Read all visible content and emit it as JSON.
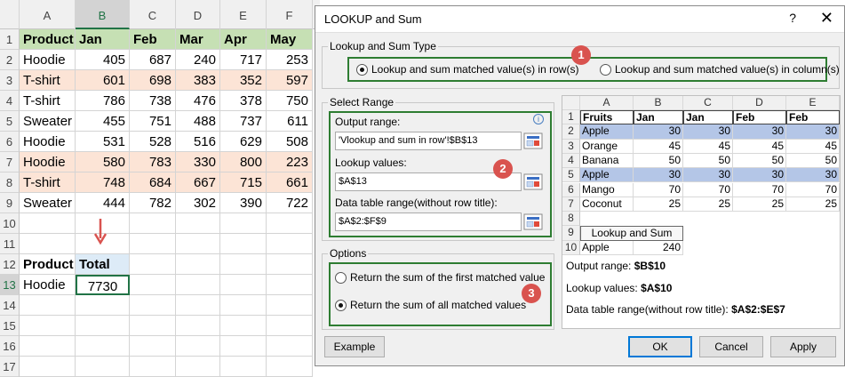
{
  "sheet": {
    "columns": [
      "A",
      "B",
      "C",
      "D",
      "E",
      "F"
    ],
    "rows": [
      "1",
      "2",
      "3",
      "4",
      "5",
      "6",
      "7",
      "8",
      "9",
      "10",
      "11",
      "12",
      "13",
      "14",
      "15",
      "16",
      "17"
    ],
    "header": [
      "Product",
      "Jan",
      "Feb",
      "Mar",
      "Apr",
      "May"
    ],
    "data": [
      [
        "Hoodie",
        "405",
        "687",
        "240",
        "717",
        "253"
      ],
      [
        "T-shirt",
        "601",
        "698",
        "383",
        "352",
        "597"
      ],
      [
        "T-shirt",
        "786",
        "738",
        "476",
        "378",
        "750"
      ],
      [
        "Sweater",
        "455",
        "751",
        "488",
        "737",
        "611"
      ],
      [
        "Hoodie",
        "531",
        "528",
        "516",
        "629",
        "508"
      ],
      [
        "Hoodie",
        "580",
        "783",
        "330",
        "800",
        "223"
      ],
      [
        "T-shirt",
        "748",
        "684",
        "667",
        "715",
        "661"
      ],
      [
        "Sweater",
        "444",
        "782",
        "302",
        "390",
        "722"
      ]
    ],
    "result_header": [
      "Product",
      "Total"
    ],
    "result_row": [
      "Hoodie",
      "7730"
    ]
  },
  "dialog": {
    "title": "LOOKUP and Sum",
    "help": "?",
    "close": "✕",
    "type_group": "Lookup and Sum Type",
    "type_row": "Lookup and sum matched value(s) in row(s)",
    "type_col": "Lookup and sum matched value(s) in column(s)",
    "range_group": "Select Range",
    "output_label": "Output range:",
    "output_value": "'Vlookup and sum in row'!$B$13",
    "lookup_label": "Lookup values:",
    "lookup_value": "$A$13",
    "table_label": "Data table range(without row title):",
    "table_value": "$A$2:$F$9",
    "options_group": "Options",
    "opt_first": "Return the sum of the first matched value",
    "opt_all": "Return the sum of all matched values",
    "badges": [
      "1",
      "2",
      "3"
    ],
    "example_btn": "Example",
    "ok_btn": "OK",
    "cancel_btn": "Cancel",
    "apply_btn": "Apply",
    "info_icon": "i"
  },
  "preview": {
    "columns": [
      "A",
      "B",
      "C",
      "D",
      "E"
    ],
    "rows": [
      "1",
      "2",
      "3",
      "4",
      "5",
      "6",
      "7",
      "8",
      "9",
      "10"
    ],
    "header": [
      "Fruits",
      "Jan",
      "Jan",
      "Feb",
      "Feb"
    ],
    "data": [
      [
        "Apple",
        "30",
        "30",
        "30",
        "30"
      ],
      [
        "Orange",
        "45",
        "45",
        "45",
        "45"
      ],
      [
        "Banana",
        "50",
        "50",
        "50",
        "50"
      ],
      [
        "Apple",
        "30",
        "30",
        "30",
        "30"
      ],
      [
        "Mango",
        "70",
        "70",
        "70",
        "70"
      ],
      [
        "Coconut",
        "25",
        "25",
        "25",
        "25"
      ]
    ],
    "ls_title": "Lookup and Sum",
    "ls_name": "Apple",
    "ls_value": "240",
    "info_output_label": "Output range:",
    "info_output_value": "$B$10",
    "info_lookup_label": "Lookup values:",
    "info_lookup_value": "$A$10",
    "info_table_label": "Data table range(without row title):",
    "info_table_value": "$A$2:$E$7"
  },
  "colors": {
    "header_green": "#c6e0b4",
    "highlight_peach": "#fce4d6",
    "preview_blue": "#b4c6e7",
    "badge_red": "#d9534f",
    "box_green": "#2e7d32"
  }
}
